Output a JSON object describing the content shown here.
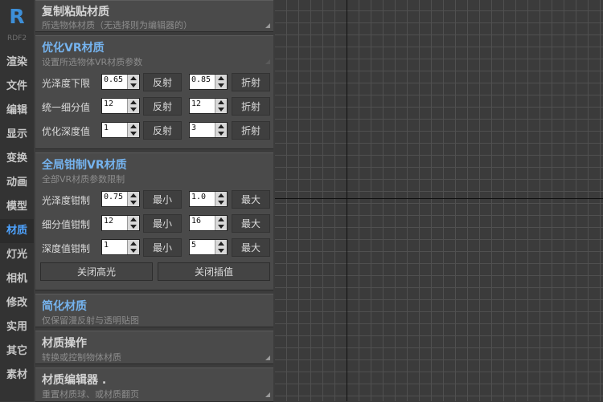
{
  "logo": {
    "letter": "R",
    "version": "RDF2"
  },
  "nav": [
    {
      "label": "渲染"
    },
    {
      "label": "文件"
    },
    {
      "label": "编辑"
    },
    {
      "label": "显示"
    },
    {
      "label": "变换"
    },
    {
      "label": "动画"
    },
    {
      "label": "模型"
    },
    {
      "label": "材质"
    },
    {
      "label": "灯光"
    },
    {
      "label": "相机"
    },
    {
      "label": "修改"
    },
    {
      "label": "实用"
    },
    {
      "label": "其它"
    },
    {
      "label": "素材"
    }
  ],
  "active_nav": "材质",
  "rollouts": {
    "copy_paste": {
      "title": "复制粘贴材质",
      "subtitle": "所选物体材质（无选择则为编辑器的）"
    },
    "optimize": {
      "title": "优化VR材质",
      "subtitle": "设置所选物体VR材质参数",
      "rows": [
        {
          "label": "光泽度下限",
          "v1": "0.65",
          "b1": "反射",
          "v2": "0.85",
          "b2": "折射"
        },
        {
          "label": "统一细分值",
          "v1": "12",
          "b1": "反射",
          "v2": "12",
          "b2": "折射"
        },
        {
          "label": "优化深度值",
          "v1": "1",
          "b1": "反射",
          "v2": "3",
          "b2": "折射"
        }
      ]
    },
    "clamp": {
      "title": "全局钳制VR材质",
      "subtitle": "全部VR材质参数限制",
      "rows": [
        {
          "label": "光泽度钳制",
          "v1": "0.75",
          "b1": "最小",
          "v2": "1.0",
          "b2": "最大"
        },
        {
          "label": "细分值钳制",
          "v1": "12",
          "b1": "最小",
          "v2": "16",
          "b2": "最大"
        },
        {
          "label": "深度值钳制",
          "v1": "1",
          "b1": "最小",
          "v2": "5",
          "b2": "最大"
        }
      ],
      "close_highlight": "关闭高光",
      "close_interp": "关闭插值"
    },
    "simplify": {
      "title": "简化材质",
      "subtitle": "仅保留漫反射与透明贴图"
    },
    "operate": {
      "title": "材质操作",
      "subtitle": "转换或控制物体材质"
    },
    "editor": {
      "title": "材质编辑器 .",
      "subtitle": "重置材质球、或材质翻页"
    }
  },
  "colors": {
    "accent": "#4ea3ff",
    "title_blue": "#75b3ee",
    "grid_line": "#505050",
    "axis": "#101010"
  }
}
